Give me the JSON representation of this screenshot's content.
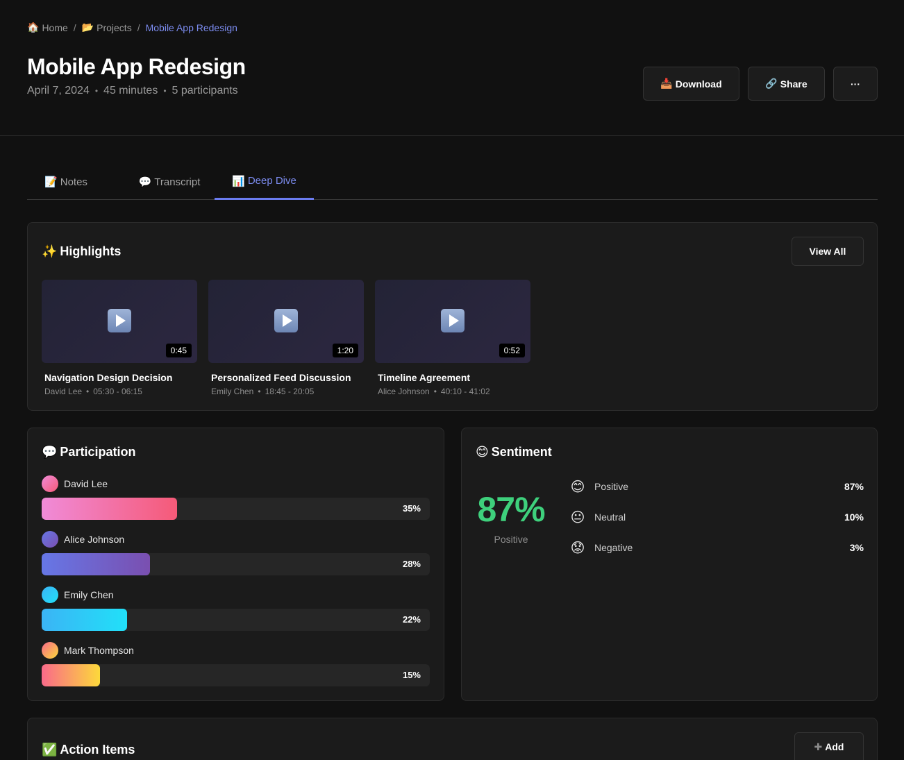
{
  "breadcrumb": {
    "home_icon": "house-icon",
    "home": "Home",
    "projects_icon": "folder-icon",
    "projects": "Projects",
    "current": "Mobile App Redesign",
    "separator": "/"
  },
  "header": {
    "title": "Mobile App Redesign",
    "date": "April 7, 2024",
    "duration": "45 minutes",
    "participants": "5 participants",
    "dot": "•",
    "download_label": "Download",
    "download_icon": "inbox-tray-icon",
    "share_label": "Share",
    "share_icon": "link-icon",
    "more_label": "···"
  },
  "tabs": [
    {
      "label": "Notes",
      "icon": "memo-icon"
    },
    {
      "label": "Transcript",
      "icon": "speech-bubble-icon"
    },
    {
      "label": "Deep Dive",
      "icon": "bar-chart-icon",
      "active": true
    }
  ],
  "highlights": {
    "title": "Highlights",
    "title_icon": "sparkles-icon",
    "view_all": "View All",
    "clips": [
      {
        "title": "Navigation Design Decision",
        "speaker": "David Lee",
        "range": "05:30 - 06:15",
        "duration": "0:45"
      },
      {
        "title": "Personalized Feed Discussion",
        "speaker": "Emily Chen",
        "range": "18:45 - 20:05",
        "duration": "1:20"
      },
      {
        "title": "Timeline Agreement",
        "speaker": "Alice Johnson",
        "range": "40:10 - 41:02",
        "duration": "0:52"
      }
    ]
  },
  "participation": {
    "title": "Participation",
    "title_icon": "speech-bubble-icon",
    "people": [
      {
        "name": "David Lee",
        "percent": "35%",
        "share": 0.35,
        "color_from": "#f08bd8",
        "color_to": "#f55a78"
      },
      {
        "name": "Alice Johnson",
        "percent": "28%",
        "share": 0.28,
        "color_from": "#6677e6",
        "color_to": "#7a4fb0"
      },
      {
        "name": "Emily Chen",
        "percent": "22%",
        "share": 0.22,
        "color_from": "#3bb4f5",
        "color_to": "#21e0f8"
      },
      {
        "name": "Mark Thompson",
        "percent": "15%",
        "share": 0.15,
        "color_from": "#f96a8a",
        "color_to": "#fcd93b"
      }
    ]
  },
  "sentiment": {
    "title": "Sentiment",
    "title_icon": "smiling-face-icon",
    "big_value": "87%",
    "big_label": "Positive",
    "big_color": "#3ed07c",
    "rows": [
      {
        "label": "Positive",
        "value": "87%",
        "icon": "smiling-face-icon"
      },
      {
        "label": "Neutral",
        "value": "10%",
        "icon": "neutral-face-icon"
      },
      {
        "label": "Negative",
        "value": "3%",
        "icon": "worried-face-icon"
      }
    ]
  },
  "action_items": {
    "title": "Action Items",
    "title_icon": "check-mark-icon",
    "add_label": "Add",
    "add_icon": "plus-icon"
  },
  "colors": {
    "accent": "#7c8cf0",
    "background": "#111111",
    "card": "#1b1b1b"
  }
}
